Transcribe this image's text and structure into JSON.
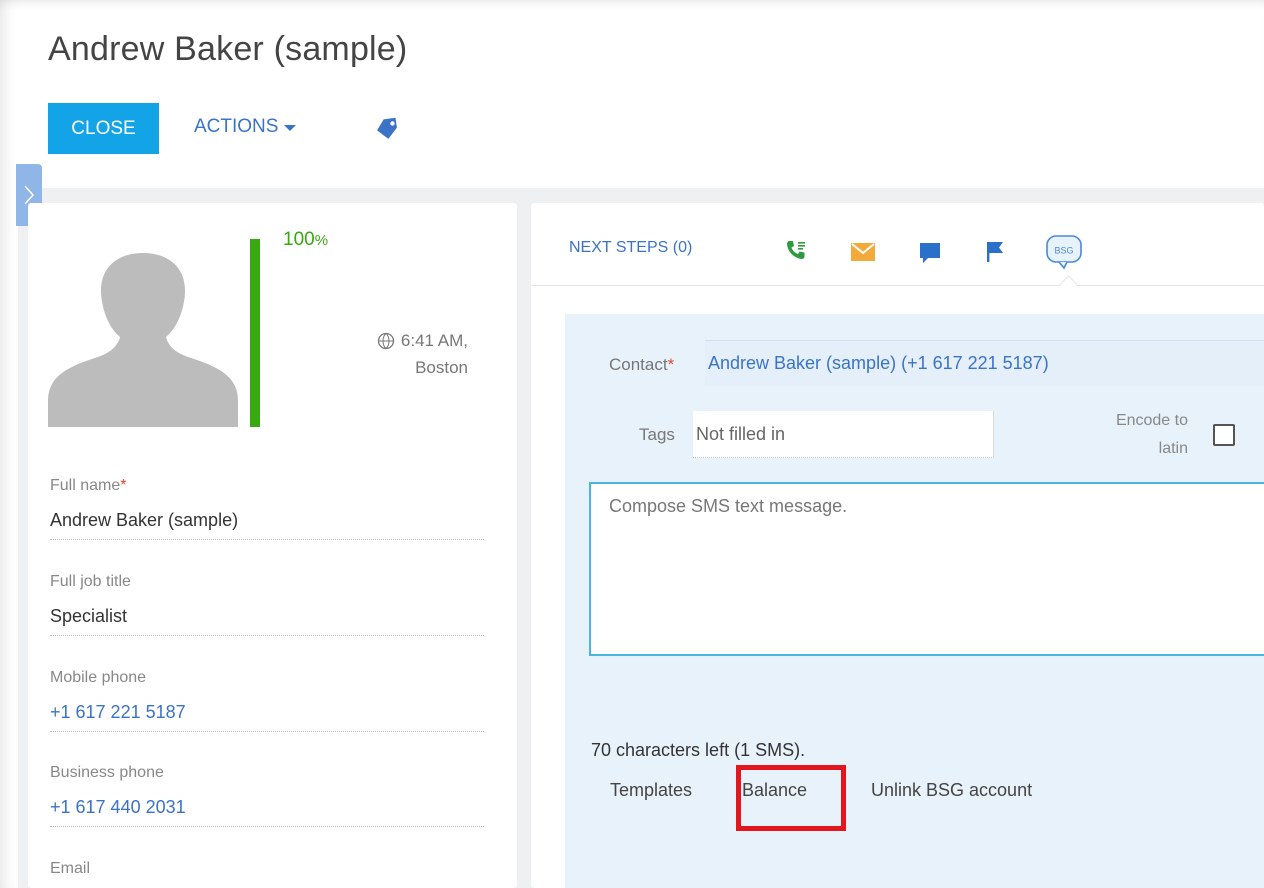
{
  "header": {
    "title": "Andrew Baker (sample)",
    "close_label": "CLOSE",
    "actions_label": "ACTIONS"
  },
  "profile": {
    "completeness_label": "100",
    "completeness_unit": "%",
    "completeness_value": 1.0,
    "time": "6:41 AM,",
    "city": "Boston"
  },
  "fields": [
    {
      "label": "Full name",
      "required": "*",
      "value": "Andrew Baker (sample)"
    },
    {
      "label": "Full job title",
      "value": "Specialist"
    },
    {
      "label": "Mobile phone",
      "value": "+1 617 221 5187"
    },
    {
      "label": "Business phone",
      "value": "+1 617 440 2031"
    },
    {
      "label": "Email"
    }
  ],
  "tabs": {
    "next_steps": "NEXT STEPS (0)",
    "icons": [
      "phone-icon",
      "email-icon",
      "chat-icon",
      "flag-icon",
      "bsg-sms-icon"
    ],
    "bsg_badge": "BSG"
  },
  "sms": {
    "contact_label": "Contact",
    "contact_required": "*",
    "contact_value": "Andrew Baker (sample) (+1 617 221 5187)",
    "tags_label": "Tags",
    "tags_placeholder": "Not filled in",
    "encode_label_1": "Encode to",
    "encode_label_2": "latin",
    "message_placeholder": "Compose SMS text message.",
    "chars_left": "70 characters left (1 SMS).",
    "templates": "Templates",
    "balance": "Balance",
    "unlink": "Unlink BSG account"
  },
  "colors": {
    "accent_blue": "#12a4e6",
    "link_blue": "#3b73c6",
    "progress_green": "#3aa812",
    "highlight_red": "#e3151e",
    "panel_bg": "#e8f2fb"
  }
}
